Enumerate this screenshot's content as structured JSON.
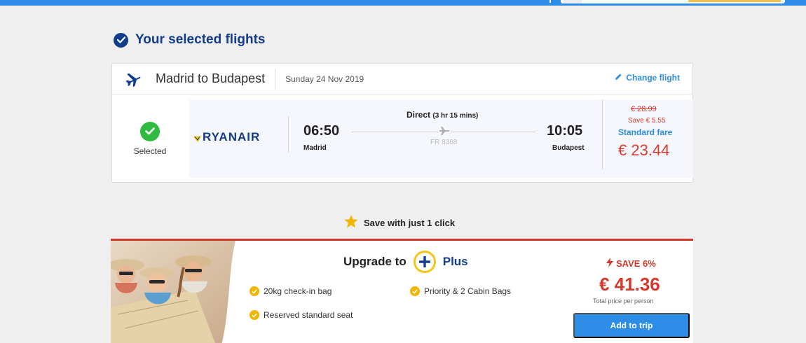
{
  "colors": {
    "brand_blue": "#2d8de6",
    "navy": "#123c8c",
    "red": "#d33a2c",
    "green": "#2ebb3f",
    "gold": "#f2b600"
  },
  "page": {
    "section_title": "Your selected flights",
    "section_icon": "check-circle-icon"
  },
  "flight": {
    "plane_icon": "airplane-icon",
    "route": "Madrid to Budapest",
    "date": "Sunday 24 Nov 2019",
    "change_label": "Change flight",
    "status_label": "Selected",
    "airline": "RYANAIR",
    "departure_time": "06:50",
    "departure_city": "Madrid",
    "arrival_time": "10:05",
    "arrival_city": "Budapest",
    "stops": "Direct",
    "duration": "(3 hr 15 mins)",
    "flight_number": "FR 8368",
    "old_price": "€ 28.99",
    "saving": "Save € 5.55",
    "fare_name": "Standard fare",
    "price": "€ 23.44"
  },
  "promo": {
    "headline": "Save with just 1 click"
  },
  "upgrade": {
    "prefix": "Upgrade to",
    "product": "Plus",
    "features": [
      "20kg check-in bag",
      "Priority & 2 Cabin Bags",
      "Reserved standard seat"
    ],
    "save_badge": "SAVE 6%",
    "price": "€ 41.36",
    "price_note": "Total price per person",
    "cta": "Add to trip"
  }
}
